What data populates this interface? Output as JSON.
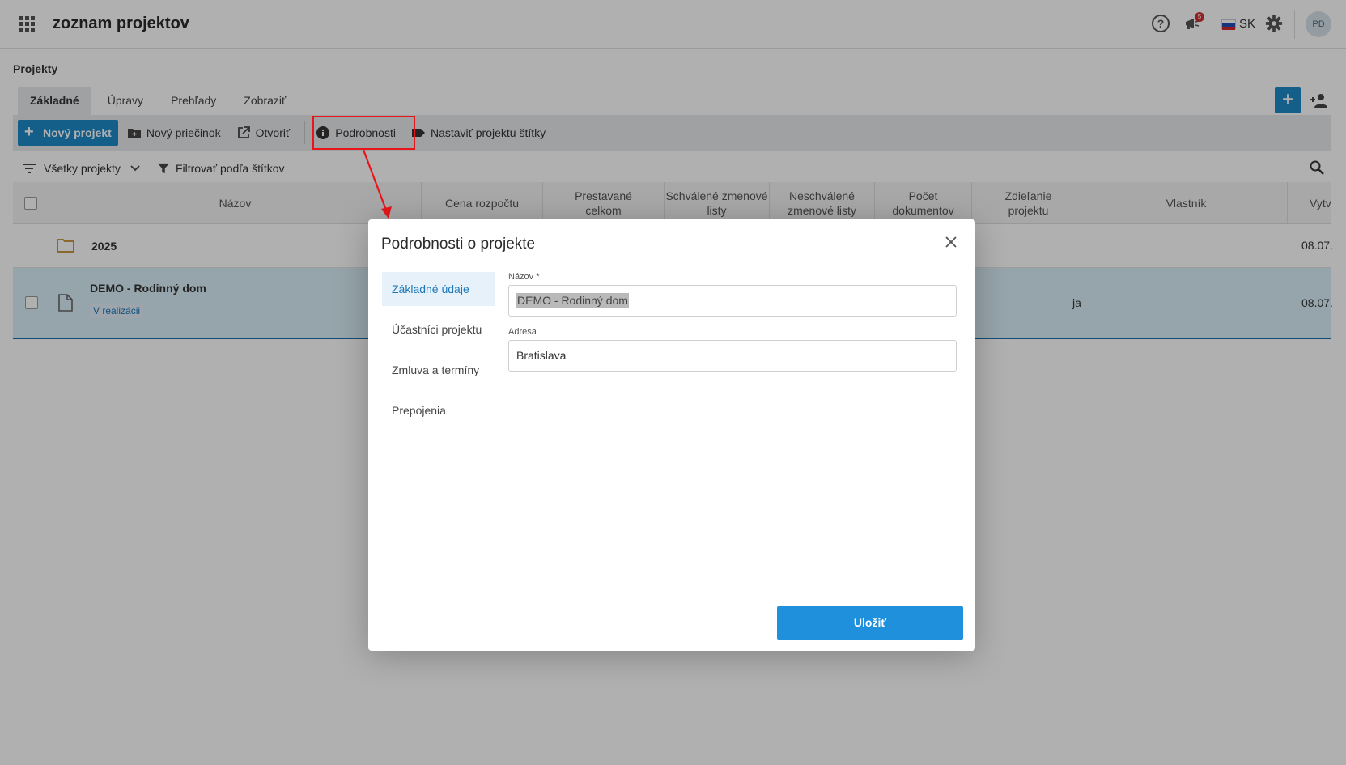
{
  "app": {
    "title": "zoznam projektov",
    "language": "SK",
    "avatar_initials": "PD",
    "notification_count": "5"
  },
  "section": {
    "title": "Projekty"
  },
  "tabs": [
    {
      "label": "Základné",
      "active": true
    },
    {
      "label": "Úpravy"
    },
    {
      "label": "Prehľady"
    },
    {
      "label": "Zobraziť"
    }
  ],
  "toolbar": {
    "new_project": "Nový projekt",
    "new_folder": "Nový priečinok",
    "open": "Otvoriť",
    "details": "Podrobnosti",
    "set_tags": "Nastaviť projektu štítky"
  },
  "filters": {
    "all_projects": "Všetky projekty",
    "filter_by_tags": "Filtrovať podľa štítkov"
  },
  "table": {
    "columns": {
      "name": "Názov",
      "budget": "Cena rozpočtu",
      "built_total": "Prestavané celkom",
      "approved_changes": "Schválené zmenové listy",
      "unapproved_changes": "Neschválené zmenové listy",
      "doc_count": "Počet dokumentov",
      "sharing": "Zdieľanie projektu",
      "owner": "Vlastník",
      "created": "Vytvor"
    },
    "rows": [
      {
        "name": "2025",
        "created": "08.07."
      },
      {
        "name": "DEMO - Rodinný dom",
        "status": "V realizácii",
        "owner": "ja",
        "created": "08.07."
      }
    ]
  },
  "dialog": {
    "title": "Podrobnosti o projekte",
    "nav": [
      "Základné údaje",
      "Účastníci projektu",
      "Zmluva a termíny",
      "Prepojenia"
    ],
    "fields": {
      "name_label": "Názov *",
      "name_value": "DEMO - Rodinný dom",
      "address_label": "Adresa",
      "address_value": "Bratislava"
    },
    "save_label": "Uložiť"
  },
  "colors": {
    "accent": "#1e88c8",
    "highlight": "#e8151b"
  }
}
